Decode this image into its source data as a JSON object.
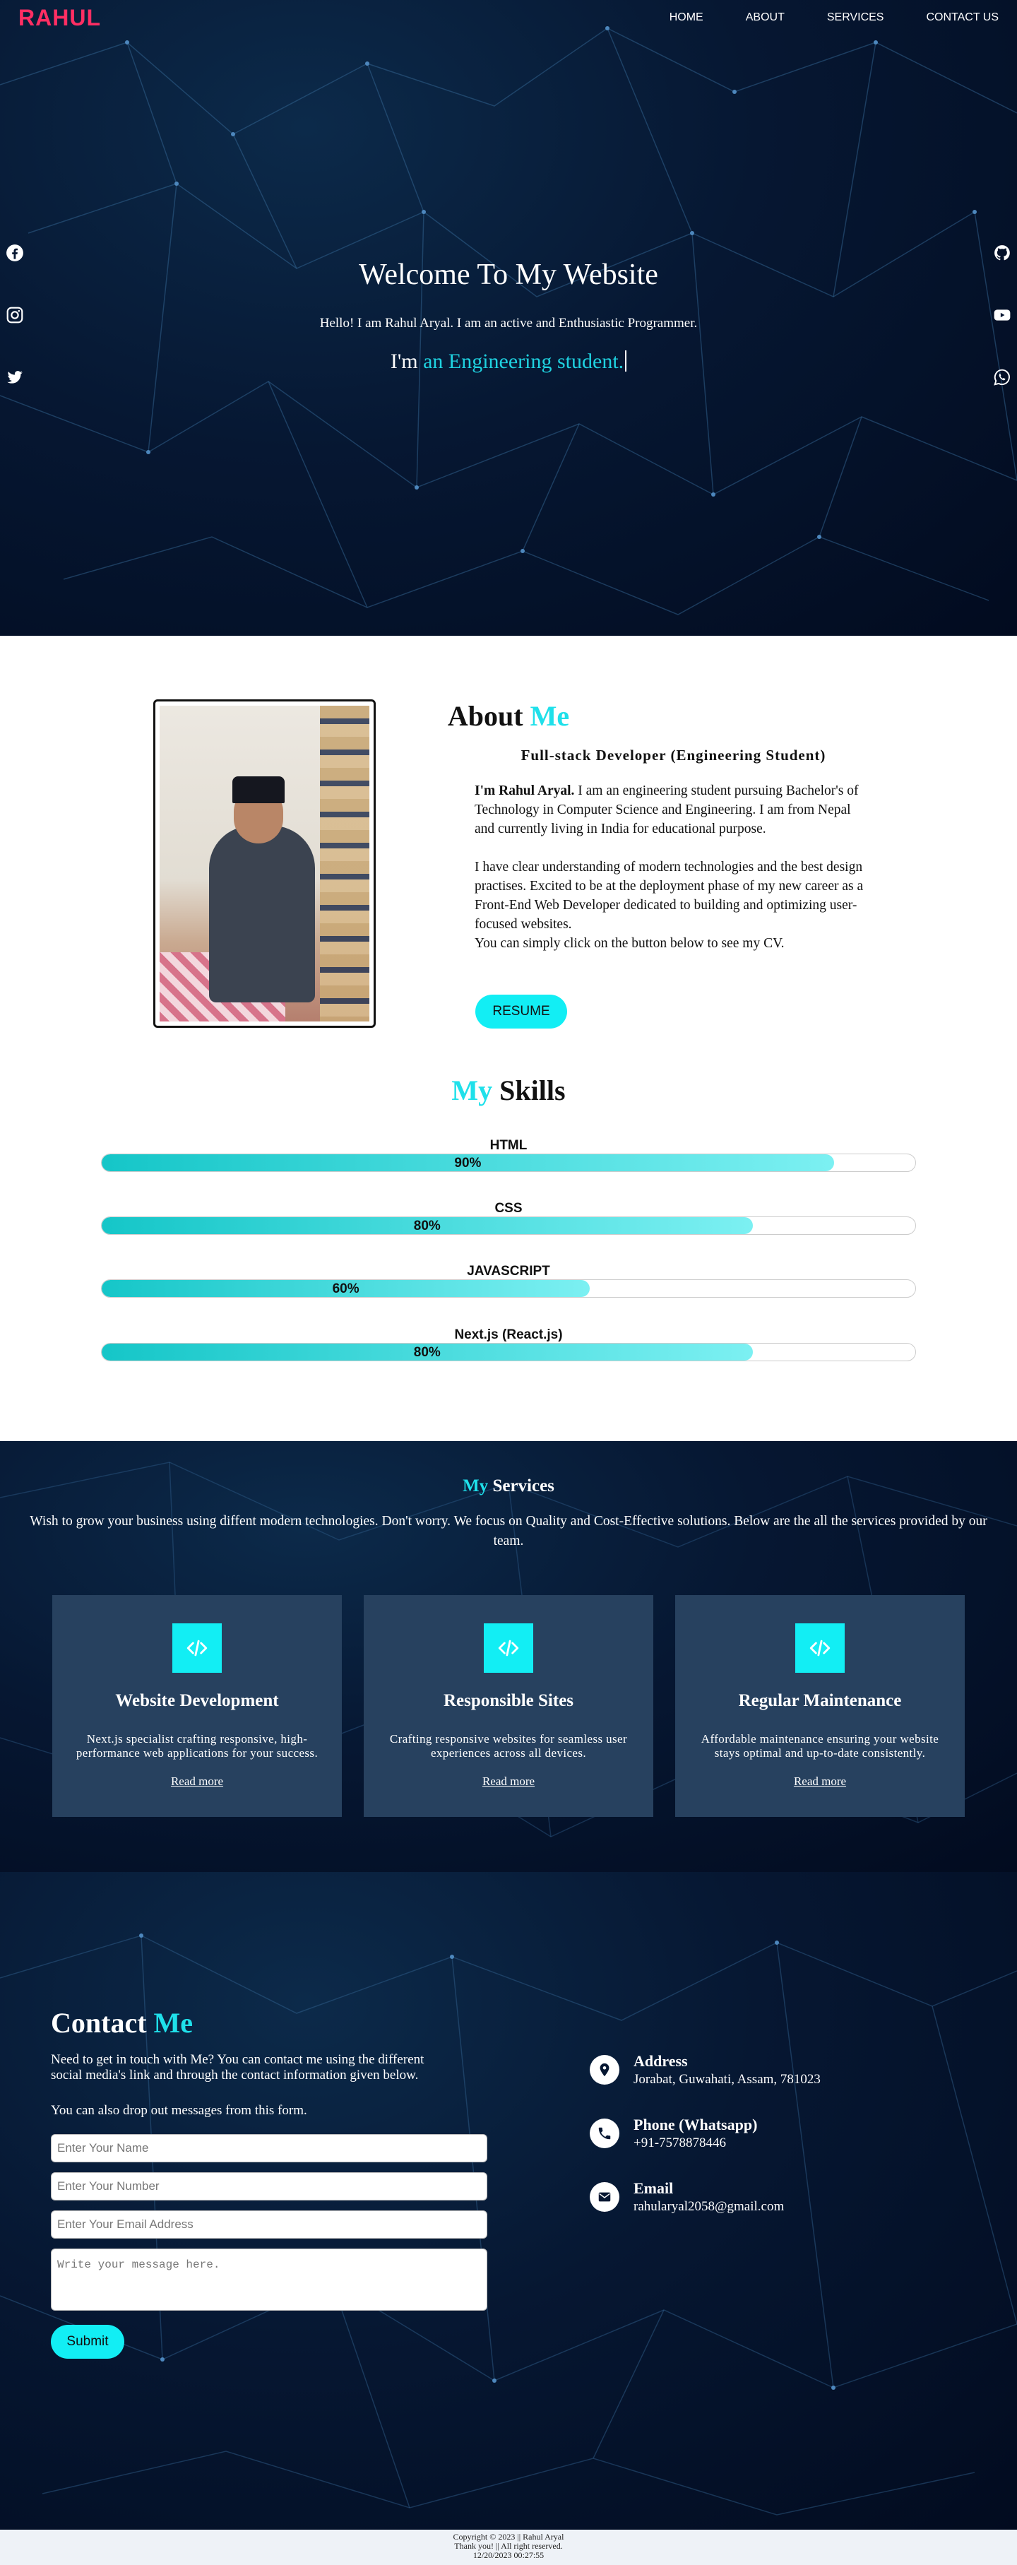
{
  "nav": {
    "logo": "RAHUL",
    "links": [
      "HOME",
      "ABOUT",
      "SERVICES",
      "CONTACT US"
    ]
  },
  "hero": {
    "title": "Welcome To My Website",
    "subtitle": "Hello! I am Rahul Aryal. I am an active and Enthusiastic Programmer.",
    "typed_prefix": "I'm",
    "typed_text": "an Engineering student.",
    "social_left": [
      "facebook-icon",
      "instagram-icon",
      "twitter-icon"
    ],
    "social_right": [
      "github-icon",
      "youtube-icon",
      "whatsapp-icon"
    ]
  },
  "about": {
    "title_main": "About",
    "title_accent": "Me",
    "role": "Full-stack Developer (Engineering Student)",
    "name": "I'm Rahul Aryal.",
    "para1": "I am an engineering student pursuing Bachelor's of Technology in Computer Science and Engineering. I am from Nepal and currently living in India for educational purpose.",
    "para2a": "I have clear understanding of modern technologies and the best design practises. Excited to be at the deployment phase of my new career as a Front-End Web Developer dedicated to building and optimizing user-focused websites.",
    "para2b": "You can simply click on the button below to see my CV.",
    "resume_label": "RESUME"
  },
  "skills": {
    "title_accent": "My",
    "title_main": "Skills",
    "items": [
      {
        "name": "HTML",
        "percent": 90,
        "label": "90%"
      },
      {
        "name": "CSS",
        "percent": 80,
        "label": "80%"
      },
      {
        "name": "JAVASCRIPT",
        "percent": 60,
        "label": "60%"
      },
      {
        "name": "Next.js (React.js)",
        "percent": 80,
        "label": "80%"
      }
    ]
  },
  "services": {
    "title_accent": "My",
    "title_main": "Services",
    "intro": "Wish to grow your business using diffent modern technologies. Don't worry. We focus on Quality and Cost-Effective solutions. Below are the all the services provided by our team.",
    "cards": [
      {
        "name": "Website Development",
        "desc": "Next.js specialist crafting responsive, high-performance web applications for your success.",
        "link": "Read more"
      },
      {
        "name": "Responsible Sites",
        "desc": "Crafting responsive websites for seamless user experiences across all devices.",
        "link": "Read more"
      },
      {
        "name": "Regular Maintenance",
        "desc": "Affordable maintenance ensuring your website stays optimal and up-to-date consistently.",
        "link": "Read more"
      }
    ],
    "icon": "code-icon"
  },
  "contact": {
    "title_main": "Contact",
    "title_accent": "Me",
    "text1": "Need to get in touch with Me? You can contact me using the different social media's link and through the contact information given below.",
    "text2": "You can also drop out messages from this form.",
    "placeholders": {
      "name": "Enter Your Name",
      "number": "Enter Your Number",
      "email": "Enter Your Email Address",
      "message": "Write your message here."
    },
    "submit_label": "Submit",
    "info": [
      {
        "icon": "location-pin-icon",
        "label": "Address",
        "value": "Jorabat, Guwahati, Assam, 781023"
      },
      {
        "icon": "phone-icon",
        "label": "Phone (Whatsapp)",
        "value": "+91-7578878446"
      },
      {
        "icon": "envelope-icon",
        "label": "Email",
        "value": "rahularyal2058@gmail.com"
      }
    ]
  },
  "footer": {
    "copyright": "Copyright © 2023 || Rahul Aryal",
    "thanks": "Thank you! || All right reserved.",
    "datetime": "12/20/2023 00:27:55"
  },
  "colors": {
    "accent": "#12eef4",
    "logo": "#ff2e63",
    "card": "#27415f",
    "dark_bg": "#061732"
  }
}
